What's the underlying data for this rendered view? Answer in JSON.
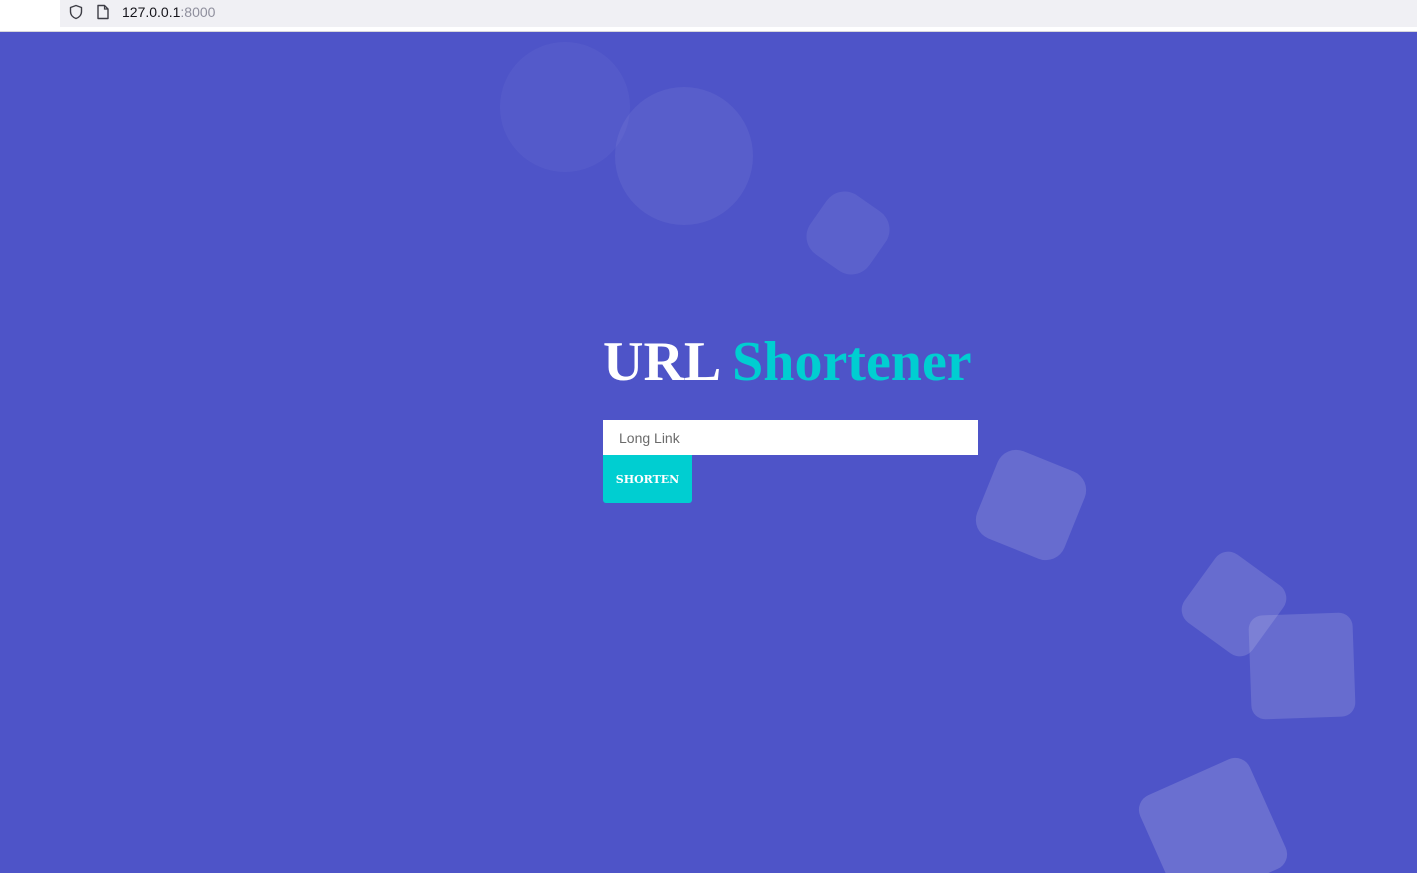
{
  "browser": {
    "url_host": "127.0.0.1",
    "url_port": ":8000"
  },
  "main": {
    "title_part1": "URL",
    "title_part2": "Shortener",
    "input_placeholder": "Long Link",
    "input_value": "",
    "button_label": "SHORTEN"
  },
  "colors": {
    "background": "#4e54c8",
    "accent": "#00ced1",
    "title": "#ffffff"
  },
  "icons": [
    "shield-icon",
    "page-icon"
  ]
}
